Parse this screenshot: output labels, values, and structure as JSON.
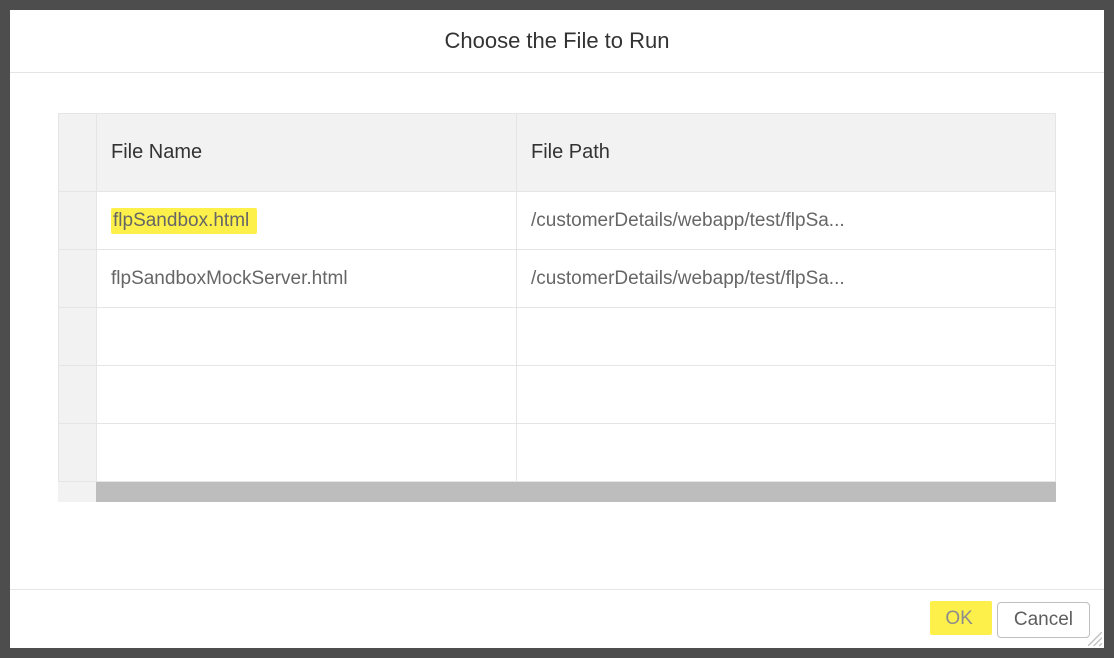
{
  "dialog": {
    "title": "Choose the File to Run"
  },
  "table": {
    "headers": {
      "name": "File Name",
      "path": "File Path"
    },
    "rows": [
      {
        "name": "flpSandbox.html",
        "path": "/customerDetails/webapp/test/flpSa...",
        "highlighted": true
      },
      {
        "name": "flpSandboxMockServer.html",
        "path": "/customerDetails/webapp/test/flpSa...",
        "highlighted": false
      }
    ]
  },
  "footer": {
    "ok_label": "OK",
    "cancel_label": "Cancel"
  }
}
